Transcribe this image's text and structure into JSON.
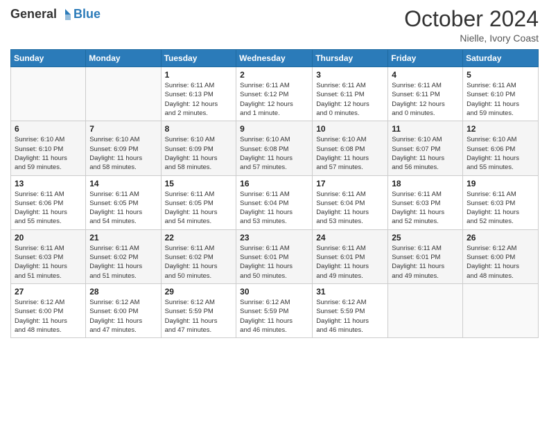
{
  "logo": {
    "general": "General",
    "blue": "Blue"
  },
  "header": {
    "month": "October 2024",
    "location": "Nielle, Ivory Coast"
  },
  "weekdays": [
    "Sunday",
    "Monday",
    "Tuesday",
    "Wednesday",
    "Thursday",
    "Friday",
    "Saturday"
  ],
  "weeks": [
    [
      {
        "day": "",
        "info": ""
      },
      {
        "day": "",
        "info": ""
      },
      {
        "day": "1",
        "info": "Sunrise: 6:11 AM\nSunset: 6:13 PM\nDaylight: 12 hours\nand 2 minutes."
      },
      {
        "day": "2",
        "info": "Sunrise: 6:11 AM\nSunset: 6:12 PM\nDaylight: 12 hours\nand 1 minute."
      },
      {
        "day": "3",
        "info": "Sunrise: 6:11 AM\nSunset: 6:11 PM\nDaylight: 12 hours\nand 0 minutes."
      },
      {
        "day": "4",
        "info": "Sunrise: 6:11 AM\nSunset: 6:11 PM\nDaylight: 12 hours\nand 0 minutes."
      },
      {
        "day": "5",
        "info": "Sunrise: 6:11 AM\nSunset: 6:10 PM\nDaylight: 11 hours\nand 59 minutes."
      }
    ],
    [
      {
        "day": "6",
        "info": "Sunrise: 6:10 AM\nSunset: 6:10 PM\nDaylight: 11 hours\nand 59 minutes."
      },
      {
        "day": "7",
        "info": "Sunrise: 6:10 AM\nSunset: 6:09 PM\nDaylight: 11 hours\nand 58 minutes."
      },
      {
        "day": "8",
        "info": "Sunrise: 6:10 AM\nSunset: 6:09 PM\nDaylight: 11 hours\nand 58 minutes."
      },
      {
        "day": "9",
        "info": "Sunrise: 6:10 AM\nSunset: 6:08 PM\nDaylight: 11 hours\nand 57 minutes."
      },
      {
        "day": "10",
        "info": "Sunrise: 6:10 AM\nSunset: 6:08 PM\nDaylight: 11 hours\nand 57 minutes."
      },
      {
        "day": "11",
        "info": "Sunrise: 6:10 AM\nSunset: 6:07 PM\nDaylight: 11 hours\nand 56 minutes."
      },
      {
        "day": "12",
        "info": "Sunrise: 6:10 AM\nSunset: 6:06 PM\nDaylight: 11 hours\nand 55 minutes."
      }
    ],
    [
      {
        "day": "13",
        "info": "Sunrise: 6:11 AM\nSunset: 6:06 PM\nDaylight: 11 hours\nand 55 minutes."
      },
      {
        "day": "14",
        "info": "Sunrise: 6:11 AM\nSunset: 6:05 PM\nDaylight: 11 hours\nand 54 minutes."
      },
      {
        "day": "15",
        "info": "Sunrise: 6:11 AM\nSunset: 6:05 PM\nDaylight: 11 hours\nand 54 minutes."
      },
      {
        "day": "16",
        "info": "Sunrise: 6:11 AM\nSunset: 6:04 PM\nDaylight: 11 hours\nand 53 minutes."
      },
      {
        "day": "17",
        "info": "Sunrise: 6:11 AM\nSunset: 6:04 PM\nDaylight: 11 hours\nand 53 minutes."
      },
      {
        "day": "18",
        "info": "Sunrise: 6:11 AM\nSunset: 6:03 PM\nDaylight: 11 hours\nand 52 minutes."
      },
      {
        "day": "19",
        "info": "Sunrise: 6:11 AM\nSunset: 6:03 PM\nDaylight: 11 hours\nand 52 minutes."
      }
    ],
    [
      {
        "day": "20",
        "info": "Sunrise: 6:11 AM\nSunset: 6:03 PM\nDaylight: 11 hours\nand 51 minutes."
      },
      {
        "day": "21",
        "info": "Sunrise: 6:11 AM\nSunset: 6:02 PM\nDaylight: 11 hours\nand 51 minutes."
      },
      {
        "day": "22",
        "info": "Sunrise: 6:11 AM\nSunset: 6:02 PM\nDaylight: 11 hours\nand 50 minutes."
      },
      {
        "day": "23",
        "info": "Sunrise: 6:11 AM\nSunset: 6:01 PM\nDaylight: 11 hours\nand 50 minutes."
      },
      {
        "day": "24",
        "info": "Sunrise: 6:11 AM\nSunset: 6:01 PM\nDaylight: 11 hours\nand 49 minutes."
      },
      {
        "day": "25",
        "info": "Sunrise: 6:11 AM\nSunset: 6:01 PM\nDaylight: 11 hours\nand 49 minutes."
      },
      {
        "day": "26",
        "info": "Sunrise: 6:12 AM\nSunset: 6:00 PM\nDaylight: 11 hours\nand 48 minutes."
      }
    ],
    [
      {
        "day": "27",
        "info": "Sunrise: 6:12 AM\nSunset: 6:00 PM\nDaylight: 11 hours\nand 48 minutes."
      },
      {
        "day": "28",
        "info": "Sunrise: 6:12 AM\nSunset: 6:00 PM\nDaylight: 11 hours\nand 47 minutes."
      },
      {
        "day": "29",
        "info": "Sunrise: 6:12 AM\nSunset: 5:59 PM\nDaylight: 11 hours\nand 47 minutes."
      },
      {
        "day": "30",
        "info": "Sunrise: 6:12 AM\nSunset: 5:59 PM\nDaylight: 11 hours\nand 46 minutes."
      },
      {
        "day": "31",
        "info": "Sunrise: 6:12 AM\nSunset: 5:59 PM\nDaylight: 11 hours\nand 46 minutes."
      },
      {
        "day": "",
        "info": ""
      },
      {
        "day": "",
        "info": ""
      }
    ]
  ]
}
